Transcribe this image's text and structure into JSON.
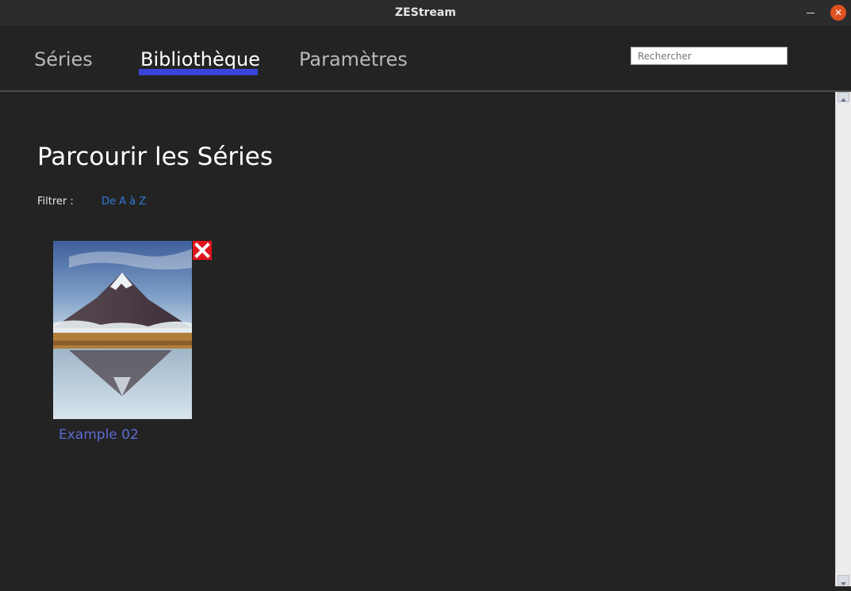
{
  "window": {
    "title": "ZEStream",
    "close_icon": "close-icon",
    "minimize_icon": "minimize-icon"
  },
  "nav": {
    "tabs": [
      {
        "label": "Séries",
        "active": false
      },
      {
        "label": "Bibliothèque",
        "active": true
      },
      {
        "label": "Paramètres",
        "active": false
      }
    ],
    "search_placeholder": "Rechercher"
  },
  "main": {
    "heading": "Parcourir les Séries",
    "filter_label": "Filtrer :",
    "filter_option": "De A à Z",
    "series": [
      {
        "name": "Example 02",
        "poster_icon": "mountain-image",
        "delete_icon": "delete-icon"
      }
    ]
  },
  "colors": {
    "accent": "#3845d8",
    "link": "#2f7bd8",
    "series_name": "#5b6bd1",
    "delete": "#e0141c",
    "background": "#232323"
  }
}
